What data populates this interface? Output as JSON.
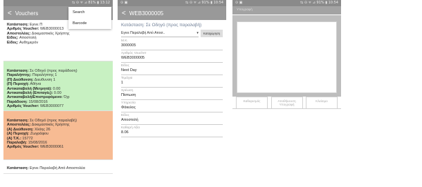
{
  "screen1": {
    "status": {
      "left": "",
      "right": "⇆ ⊙ ᯤ ⊿ 81% ▮ 13:12"
    },
    "title": "Vouchers",
    "menu": [
      "Search",
      "Barcode"
    ],
    "cards": [
      {
        "lines": [
          {
            "k": "Κατάσταση:",
            "v": " Εγινε Π"
          },
          {
            "k": "Αριθμός Voucher:",
            "v": " WEB3000013"
          },
          {
            "k": "Αποστολέας:",
            "v": " Δοκιμαστικός Χρήστης"
          },
          {
            "k": "Είδος:",
            "v": " Αποστολή"
          },
          {
            "k": "Είδος:",
            "v": " Αυθημερόν"
          }
        ]
      },
      {
        "lines": [
          {
            "k": "Κατάσταση:",
            "v": " Σε Οδηγό (προς παράδοση)"
          },
          {
            "k": "Παραλήπτης:",
            "v": " Παραλήπτης 1"
          },
          {
            "k": "(Π) Διεύθυνση:",
            "v": " Διευθυνση 1"
          },
          {
            "k": "(Π) Περιοχή:",
            "v": " Αθήνα"
          },
          {
            "k": "Αντικαταβολή (Μετρητά):",
            "v": " 0.00"
          },
          {
            "k": "Αντικαταβολή (Επιταγές):",
            "v": " 0.00"
          },
          {
            "k": "Αντικαταβολή/Επιστρεφόμενο:",
            "v": " Όχι"
          },
          {
            "k": "Παράδοση:",
            "v": " 15/08/2016"
          },
          {
            "k": "Αριθμός Voucher:",
            "v": " WEB3000077"
          }
        ]
      },
      {
        "lines": [
          {
            "k": "Κατάσταση:",
            "v": " Σε Οδηγό (προς παραλαβή)"
          },
          {
            "k": "Αποστολέας:",
            "v": " Δοκιμαστικός Χρήστης"
          },
          {
            "k": "(Α) Διεύθυνση:",
            "v": " Χλόης 26"
          },
          {
            "k": "(Α) Περιοχή:",
            "v": " Ζωγράφου"
          },
          {
            "k": "(Α) Τ.Κ.:",
            "v": " 15772"
          },
          {
            "k": "Παραλαβή:",
            "v": " 15/08/2016"
          },
          {
            "k": "Αριθμός Voucher:",
            "v": " WEB3000061"
          }
        ]
      },
      {
        "lines": [
          {
            "k": "Κατάσταση:",
            "v": " Εγινε Παραλαβή Από Αποστολέα"
          }
        ]
      }
    ]
  },
  "screen2": {
    "status": {
      "left": "⊙ ▣",
      "right": "⇆ ⊙ ᯤ ⊿ 91% ▮ 10:54"
    },
    "title": "WEB3000005",
    "status_text": "Κατάσταση: Σε Οδηγό (προς παραλαβή)",
    "select_value": "Εγινε Παραλαβή Από Αποσ..",
    "save_button": "Καταχώρηση",
    "fields": [
      {
        "label": "Μ.Κ.",
        "value": "3000005"
      },
      {
        "label": "Αριθμός Voucher",
        "value": "WEB3000005"
      },
      {
        "label": "Είδος",
        "value": "Next Day"
      },
      {
        "label": "Τεμάχια",
        "value": "1"
      },
      {
        "label": "Χρέωση",
        "value": "Πίστωση"
      },
      {
        "label": "Υπηρεσία",
        "value": "Φάκελος"
      },
      {
        "label": "Είδος",
        "value": "Αποστολή"
      },
      {
        "label": "Καθαρή Αξία",
        "value": "8.06"
      }
    ]
  },
  "screen3": {
    "status": {
      "left": "⊙ ▣",
      "right": "⇆ ⊙ ᯤ ⊿ 91% ▮ 10:54"
    },
    "sig_label": "Υπογραφή",
    "buttons": [
      "Καθαρισμός",
      "Αποθήκευση Υπογραφή",
      "Κλείσιμο"
    ]
  }
}
